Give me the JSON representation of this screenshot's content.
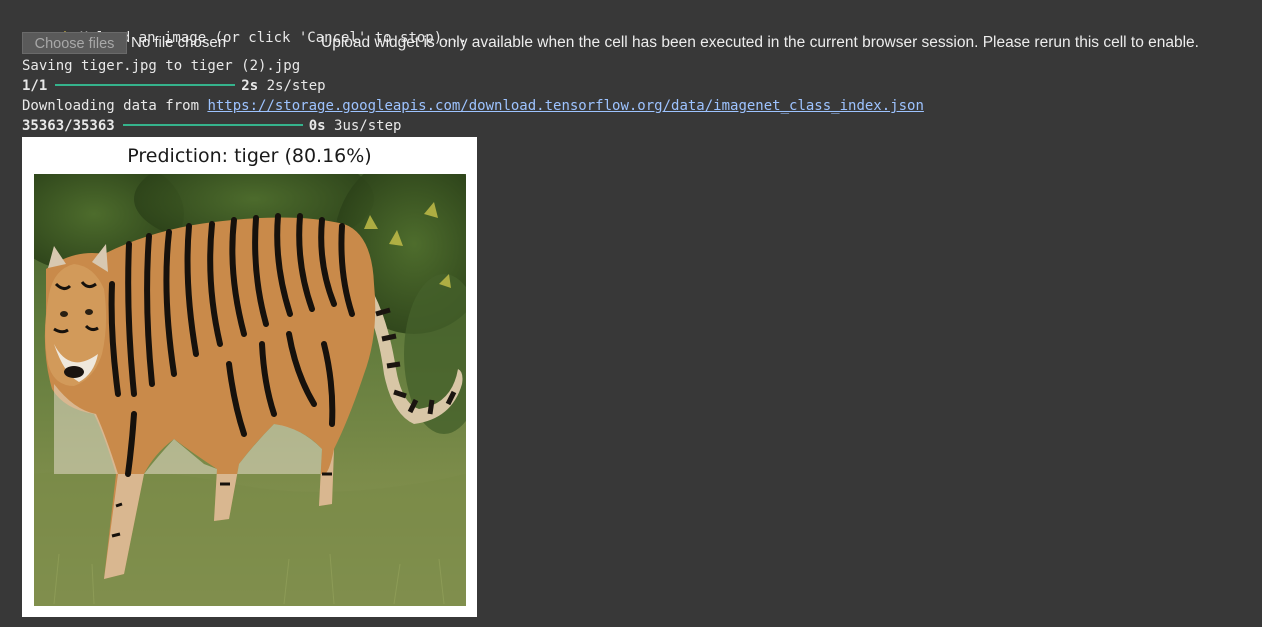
{
  "upload": {
    "prompt": "Upload an image (or click 'Cancel' to stop)...",
    "choose_label": "Choose files",
    "no_file_label": "No file chosen",
    "note": "Upload widget is only available when the cell has been executed in the current browser session. Please rerun this cell to enable."
  },
  "log": {
    "saving": "Saving tiger.jpg to tiger (2).jpg",
    "step1_count": "1/1",
    "step1_time": "2s",
    "step1_rate": "2s/step",
    "download_prefix": "Downloading data from ",
    "download_url": "https://storage.googleapis.com/download.tensorflow.org/data/imagenet_class_index.json",
    "step2_count": "35363/35363",
    "step2_time": "0s",
    "step2_rate": "3us/step"
  },
  "figure": {
    "title": "Prediction: tiger (80.16%)"
  },
  "colors": {
    "background": "#383838",
    "progress": "#35b38c",
    "link": "#9dc3ff"
  }
}
